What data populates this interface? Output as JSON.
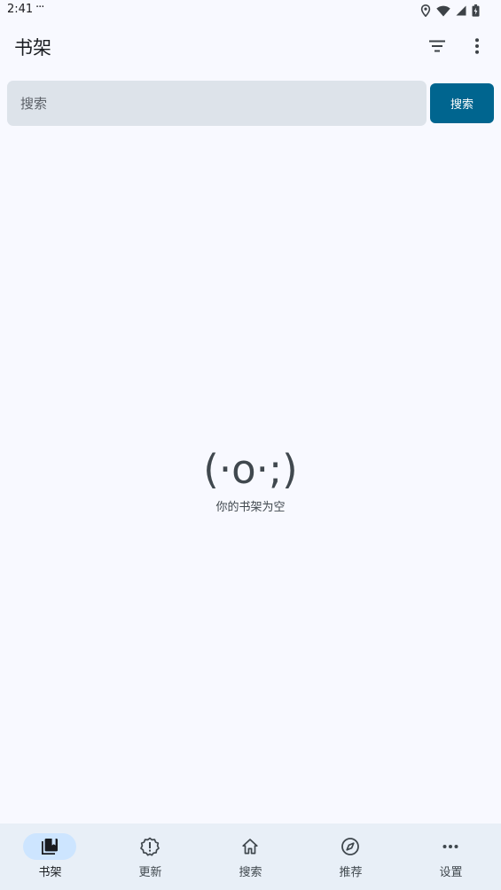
{
  "status_bar": {
    "time": "2:41",
    "notification_dots": "···",
    "icons": [
      "location-icon",
      "wifi-icon",
      "signal-icon",
      "battery-icon"
    ]
  },
  "app_bar": {
    "title": "书架",
    "actions": [
      "filter-icon",
      "more-vert-icon"
    ]
  },
  "search": {
    "placeholder": "搜索",
    "value": "",
    "button_label": "搜索"
  },
  "empty_state": {
    "kaomoji": "(·o·;)",
    "message": "你的书架为空"
  },
  "bottom_nav": {
    "items": [
      {
        "label": "书架",
        "icon": "library-icon",
        "active": true
      },
      {
        "label": "更新",
        "icon": "alert-badge-icon",
        "active": false
      },
      {
        "label": "搜索",
        "icon": "home-icon",
        "active": false
      },
      {
        "label": "推荐",
        "icon": "compass-icon",
        "active": false
      },
      {
        "label": "设置",
        "icon": "more-horiz-icon",
        "active": false
      }
    ]
  },
  "colors": {
    "background": "#f8f9ff",
    "primary": "#00658f",
    "search_field": "#dde3ea",
    "nav_background": "#e8eff7",
    "nav_active_indicator": "#cde5ff"
  }
}
